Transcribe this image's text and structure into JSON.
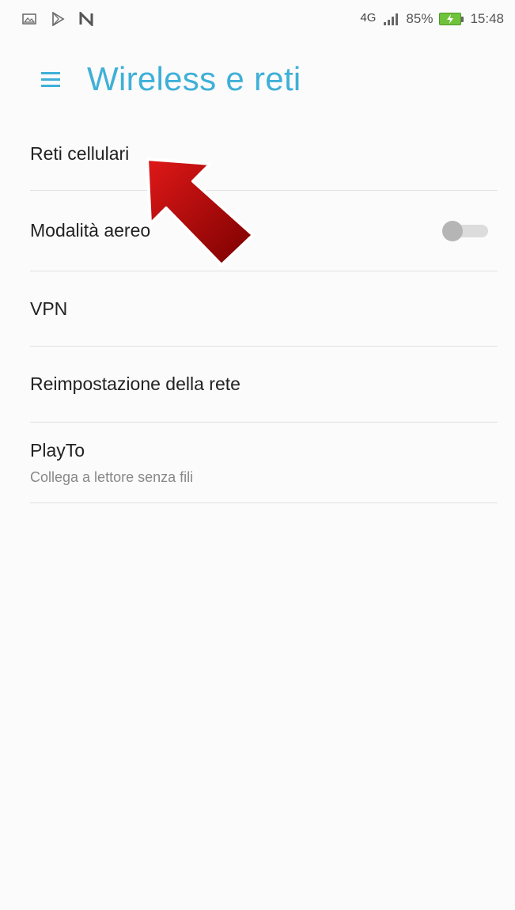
{
  "status_bar": {
    "left_icons": [
      "image-icon",
      "play-store-icon",
      "n-logo-icon"
    ],
    "network": "4G",
    "battery": "85%",
    "time": "15:48"
  },
  "app_bar": {
    "menu_icon": "hamburger-menu-icon",
    "title": "Wireless e reti"
  },
  "settings": {
    "items": [
      {
        "label": "Reti cellulari"
      },
      {
        "label": "Modalità aereo",
        "toggle": false
      },
      {
        "label": "VPN"
      },
      {
        "label": "Reimpostazione della rete"
      },
      {
        "label": "PlayTo",
        "subtitle": "Collega a lettore senza fili"
      }
    ]
  },
  "annotation": {
    "type": "pointer-arrow",
    "color": "#b80000"
  }
}
